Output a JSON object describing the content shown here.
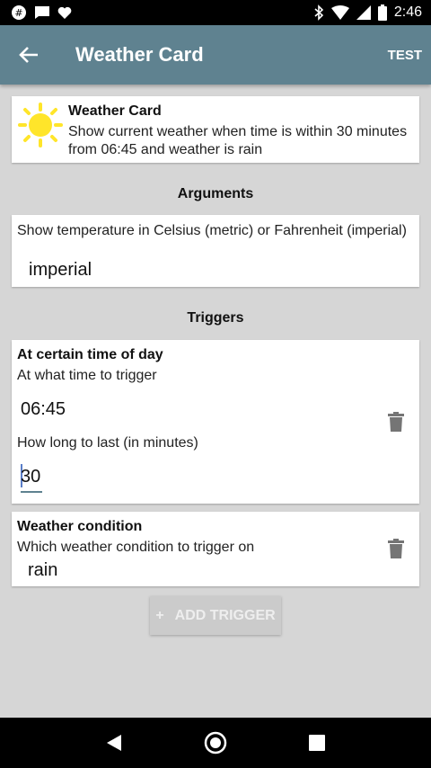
{
  "status_bar": {
    "time": "2:46"
  },
  "app_bar": {
    "title": "Weather Card",
    "action_label": "TEST"
  },
  "summary": {
    "title": "Weather Card",
    "description": "Show current weather when time is within 30 minutes from 06:45 and weather is rain"
  },
  "arguments": {
    "header": "Arguments",
    "items": [
      {
        "description": "Show temperature in Celsius (metric) or Fahrenheit (imperial)",
        "value": "imperial"
      }
    ]
  },
  "triggers": {
    "header": "Triggers",
    "items": [
      {
        "title": "At certain time of day",
        "field1_label": "At what time to trigger",
        "field1_value": "06:45",
        "field2_label": "How long to last (in minutes)",
        "field2_value": "30"
      },
      {
        "title": "Weather condition",
        "field1_label": "Which weather condition to trigger on",
        "field1_value": "rain"
      }
    ],
    "add_button_label": "ADD TRIGGER",
    "add_button_icon": "+"
  },
  "colors": {
    "app_bar": "#5f8290",
    "background": "#d6d6d6",
    "sun": "#ffe52a"
  }
}
